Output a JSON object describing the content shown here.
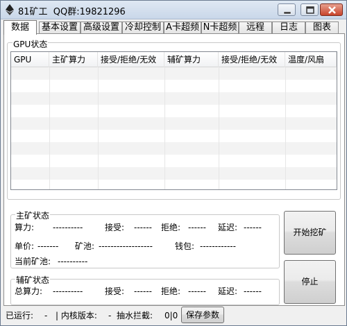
{
  "window": {
    "title": "81矿工  QQ群:19821296"
  },
  "tabs": [
    "数据",
    "基本设置",
    "高级设置",
    "冷却控制",
    "A卡超频",
    "N卡超频",
    "远程",
    "日志",
    "图表"
  ],
  "gpu_status": {
    "group_label": "GPU状态",
    "columns": [
      "GPU",
      "主矿算力",
      "接受/拒绝/无效",
      "辅矿算力",
      "接受/拒绝/无效",
      "温度/风扇"
    ],
    "rows": []
  },
  "main_mining": {
    "group_label": "主矿状态",
    "hashrate_label": "算力:",
    "hashrate_value": "----------",
    "accepted_label": "接受:",
    "accepted_value": "------",
    "rejected_label": "拒绝:",
    "rejected_value": "------",
    "latency_label": "延迟:",
    "latency_value": "------",
    "price_label": "单价:",
    "price_value": "-------",
    "pool_label": "矿池:",
    "pool_value": "------------------",
    "wallet_label": "钱包:",
    "wallet_value": "------------",
    "current_pool_label": "当前矿池:",
    "current_pool_value": "----------"
  },
  "aux_mining": {
    "group_label": "辅矿状态",
    "hashrate_label": "总算力:",
    "hashrate_value": "----------",
    "accepted_label": "接受:",
    "accepted_value": "------",
    "rejected_label": "拒绝:",
    "rejected_value": "------",
    "latency_label": "延迟:",
    "latency_value": "------"
  },
  "buttons": {
    "start": "开始挖矿",
    "stop": "停止",
    "save": "保存参数"
  },
  "statusbar": {
    "uptime_label": "已运行:",
    "uptime_value": "-",
    "kernel_label": "| 内核版本:",
    "kernel_value": "-",
    "fee_label": "抽水拦截:",
    "fee_value": "0|0"
  }
}
